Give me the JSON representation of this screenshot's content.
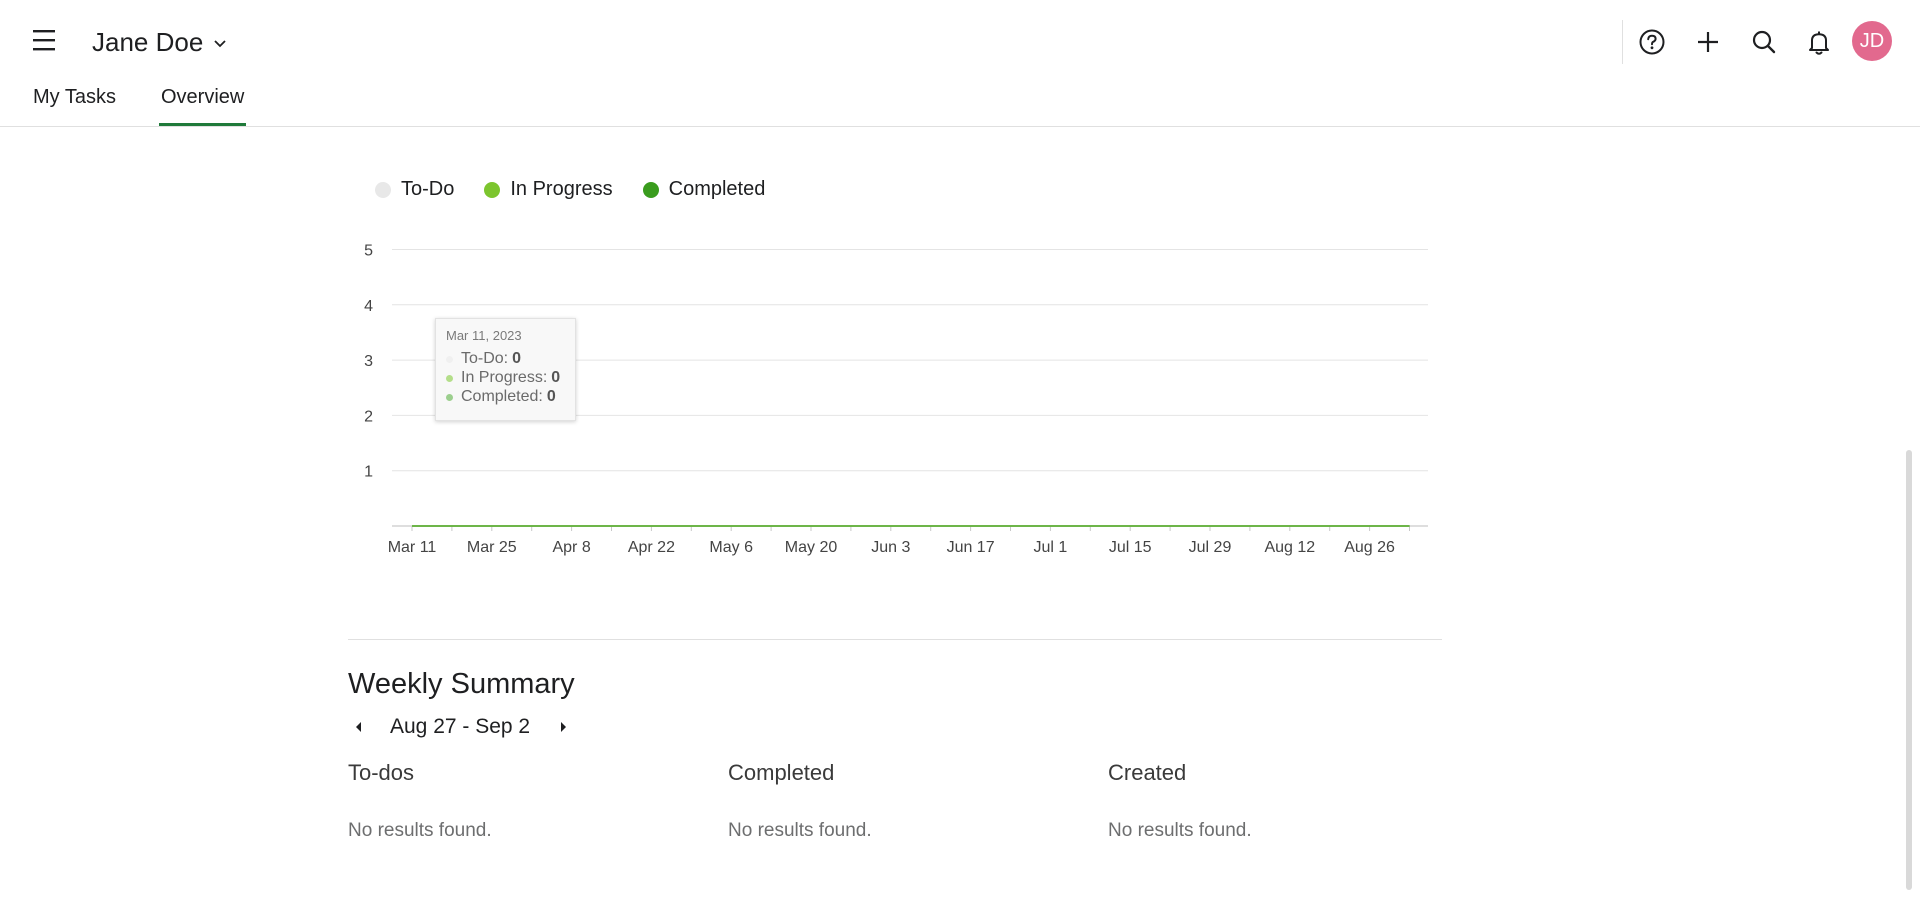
{
  "header": {
    "user_name": "Jane Doe",
    "avatar_initials": "JD",
    "avatar_color": "#e2698e",
    "icons": [
      "menu-icon",
      "chevron-down-icon",
      "help-icon",
      "plus-icon",
      "search-icon",
      "bell-icon"
    ]
  },
  "tabs": [
    {
      "label": "My Tasks",
      "active": false
    },
    {
      "label": "Overview",
      "active": true
    }
  ],
  "legend": [
    {
      "label": "To-Do",
      "color": "#e8e8e8"
    },
    {
      "label": "In Progress",
      "color": "#7cc52e"
    },
    {
      "label": "Completed",
      "color": "#3a9c1e"
    }
  ],
  "chart_data": {
    "type": "area",
    "x": [
      "Mar 11",
      "Mar 25",
      "Apr 8",
      "Apr 22",
      "May 6",
      "May 20",
      "Jun 3",
      "Jun 17",
      "Jul 1",
      "Jul 15",
      "Jul 29",
      "Aug 12",
      "Aug 26"
    ],
    "yticks": [
      1,
      2,
      3,
      4,
      5
    ],
    "ylim": [
      0,
      5
    ],
    "series": [
      {
        "name": "To-Do",
        "values": [
          0,
          0,
          0,
          0,
          0,
          0,
          0,
          0,
          0,
          0,
          0,
          0,
          0
        ]
      },
      {
        "name": "In Progress",
        "values": [
          0,
          0,
          0,
          0,
          0,
          0,
          0,
          0,
          0,
          0,
          0,
          0,
          0
        ]
      },
      {
        "name": "Completed",
        "values": [
          0,
          0,
          0,
          0,
          0,
          0,
          0,
          0,
          0,
          0,
          0,
          0,
          0
        ]
      }
    ],
    "legend_position": "top-left",
    "grid": true
  },
  "tooltip": {
    "date": "Mar 11, 2023",
    "rows": [
      {
        "label": "To-Do:",
        "value": "0"
      },
      {
        "label": "In Progress:",
        "value": "0"
      },
      {
        "label": "Completed:",
        "value": "0"
      }
    ]
  },
  "summary": {
    "title": "Weekly Summary",
    "week_range": "Aug 27 - Sep 2",
    "columns": [
      {
        "title": "To-dos",
        "empty": "No results found."
      },
      {
        "title": "Completed",
        "empty": "No results found."
      },
      {
        "title": "Created",
        "empty": "No results found."
      }
    ]
  }
}
